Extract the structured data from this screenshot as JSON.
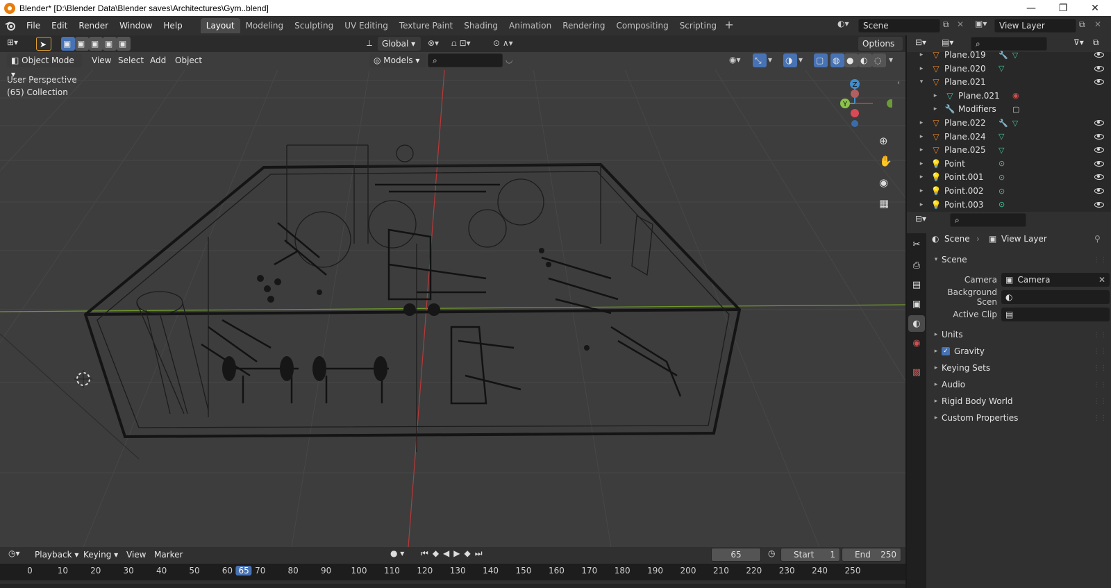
{
  "window": {
    "title": "Blender* [D:\\Blender Data\\Blender saves\\Architectures\\Gym..blend]",
    "minimize": "—",
    "maximize": "❐",
    "close": "✕"
  },
  "menubar": {
    "items": [
      "File",
      "Edit",
      "Render",
      "Window",
      "Help"
    ],
    "workspaces": [
      "Layout",
      "Modeling",
      "Sculpting",
      "UV Editing",
      "Texture Paint",
      "Shading",
      "Animation",
      "Rendering",
      "Compositing",
      "Scripting"
    ],
    "add_tab": "+",
    "scene": "Scene",
    "view_layer": "View Layer"
  },
  "viewport": {
    "transform_orientation": "Global",
    "options": "Options",
    "mode": "Object Mode",
    "menus": [
      "View",
      "Select",
      "Add",
      "Object"
    ],
    "collection_filter": "Models",
    "perspective": "User Perspective",
    "collection_info": "(65) Collection",
    "gizmo": {
      "z": "Z",
      "y": "Y"
    }
  },
  "outliner": {
    "rows": [
      {
        "label": "Plane.019",
        "type": "mesh",
        "expand": "▸",
        "indent": 0,
        "extras": [
          "wrench",
          "mesh"
        ]
      },
      {
        "label": "Plane.020",
        "type": "mesh",
        "expand": "▸",
        "indent": 0,
        "extras": [
          "mesh"
        ]
      },
      {
        "label": "Plane.021",
        "type": "mesh",
        "expand": "▾",
        "indent": 0,
        "extras": []
      },
      {
        "label": "Plane.021",
        "type": "meshdata",
        "expand": "▸",
        "indent": 1,
        "extras": [
          "material"
        ]
      },
      {
        "label": "Modifiers",
        "type": "modifier",
        "expand": "▸",
        "indent": 1,
        "extras": [
          "cube"
        ]
      },
      {
        "label": "Plane.022",
        "type": "mesh",
        "expand": "▸",
        "indent": 0,
        "extras": [
          "wrench",
          "mesh"
        ]
      },
      {
        "label": "Plane.024",
        "type": "mesh",
        "expand": "▸",
        "indent": 0,
        "extras": [
          "mesh"
        ]
      },
      {
        "label": "Plane.025",
        "type": "mesh",
        "expand": "▸",
        "indent": 0,
        "extras": [
          "mesh"
        ]
      },
      {
        "label": "Point",
        "type": "light",
        "expand": "▸",
        "indent": 0,
        "extras": [
          "lightdata"
        ]
      },
      {
        "label": "Point.001",
        "type": "light",
        "expand": "▸",
        "indent": 0,
        "extras": [
          "lightdata"
        ]
      },
      {
        "label": "Point.002",
        "type": "light",
        "expand": "▸",
        "indent": 0,
        "extras": [
          "lightdata"
        ]
      },
      {
        "label": "Point.003",
        "type": "light",
        "expand": "▸",
        "indent": 0,
        "extras": [
          "lightdata"
        ]
      }
    ]
  },
  "properties": {
    "breadcrumb_scene": "Scene",
    "breadcrumb_view_layer": "View Layer",
    "panel_title": "Scene",
    "camera_label": "Camera",
    "camera_value": "Camera",
    "background_label": "Background Scen",
    "active_clip_label": "Active Clip",
    "sections": [
      "Units",
      "Gravity",
      "Keying Sets",
      "Audio",
      "Rigid Body World",
      "Custom Properties"
    ],
    "gravity_checked": true
  },
  "timeline": {
    "menus": [
      "Playback",
      "Keying",
      "View",
      "Marker"
    ],
    "current_frame": "65",
    "start_label": "Start",
    "start_value": "1",
    "end_label": "End",
    "end_value": "250",
    "ruler": [
      "0",
      "10",
      "20",
      "30",
      "40",
      "50",
      "60",
      "65",
      "70",
      "80",
      "90",
      "100",
      "110",
      "120",
      "130",
      "140",
      "150",
      "160",
      "170",
      "180",
      "190",
      "200",
      "210",
      "220",
      "230",
      "240",
      "250"
    ],
    "playhead": 65
  },
  "colors": {
    "accent": "#4772b3",
    "mesh_icon": "#e0832d",
    "data_icon": "#44c39a",
    "x_axis": "#d64848",
    "y_axis": "#8bc34a"
  }
}
